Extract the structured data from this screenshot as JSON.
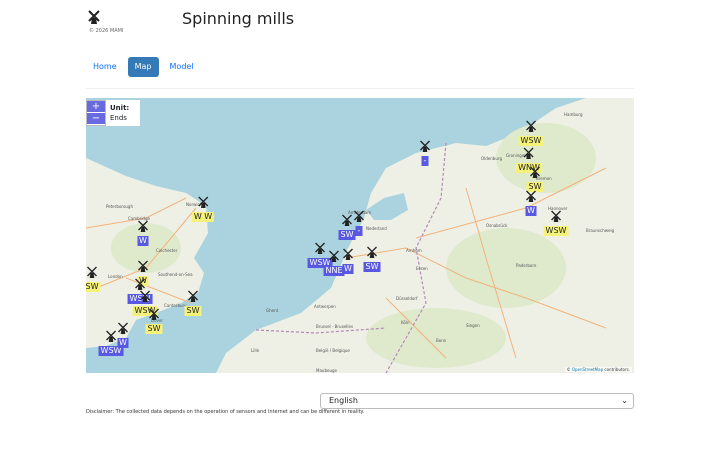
{
  "header": {
    "title": "Spinning mills",
    "copyright": "© 2026 MAMI"
  },
  "nav": {
    "items": [
      {
        "label": "Home",
        "active": false
      },
      {
        "label": "Map",
        "active": true
      },
      {
        "label": "Model",
        "active": false
      }
    ]
  },
  "map": {
    "zoom_in": "+",
    "zoom_out": "−",
    "unit_title": "Unit:",
    "unit_value": "Ends",
    "attribution_link": "OpenStreetMap",
    "attribution_text": " contributors.",
    "places": [
      "Hamburg",
      "Peterborough",
      "Norwich",
      "Cambridge",
      "Colchester",
      "London",
      "Southend-on-Sea",
      "Amsterdam",
      "Nederland",
      "Essen",
      "Düsseldorf",
      "Köln",
      "Antwerpen",
      "Brussel - Bruxelles",
      "België / Belgique",
      "Hannover",
      "Bremen",
      "Oldenburg",
      "Groningen",
      "Braunschweig",
      "Paderborn",
      "Siegen",
      "Bonn",
      "Ghent",
      "Lille",
      "Maubeuge",
      "Arnhem",
      "Osnabrück",
      "Dover",
      "Canterbury"
    ],
    "markers": [
      {
        "label": "WSW",
        "color": "yellow"
      },
      {
        "label": "WNW",
        "color": "yellow"
      },
      {
        "label": "SW",
        "color": "yellow"
      },
      {
        "label": "W",
        "color": "blue"
      },
      {
        "label": "WSW",
        "color": "yellow"
      },
      {
        "label": "-",
        "color": "blue"
      },
      {
        "label": "W W",
        "color": "yellow"
      },
      {
        "label": "W",
        "color": "blue"
      },
      {
        "label": "W",
        "color": "yellow"
      },
      {
        "label": "SW",
        "color": "yellow"
      },
      {
        "label": "WSW",
        "color": "blue"
      },
      {
        "label": "WSW",
        "color": "yellow"
      },
      {
        "label": "SW",
        "color": "yellow"
      },
      {
        "label": "SW",
        "color": "yellow"
      },
      {
        "label": "WSW",
        "color": "blue"
      },
      {
        "label": "W",
        "color": "blue"
      },
      {
        "label": "SW",
        "color": "blue"
      },
      {
        "label": "-",
        "color": "blue"
      },
      {
        "label": "WSW",
        "color": "blue"
      },
      {
        "label": "NNE",
        "color": "blue"
      },
      {
        "label": "W",
        "color": "blue"
      },
      {
        "label": "SW",
        "color": "blue"
      }
    ]
  },
  "language": {
    "selected": "English"
  },
  "disclaimer": "Disclaimer: The collected data depends on the operation of sensors and internet and can be different in reality."
}
